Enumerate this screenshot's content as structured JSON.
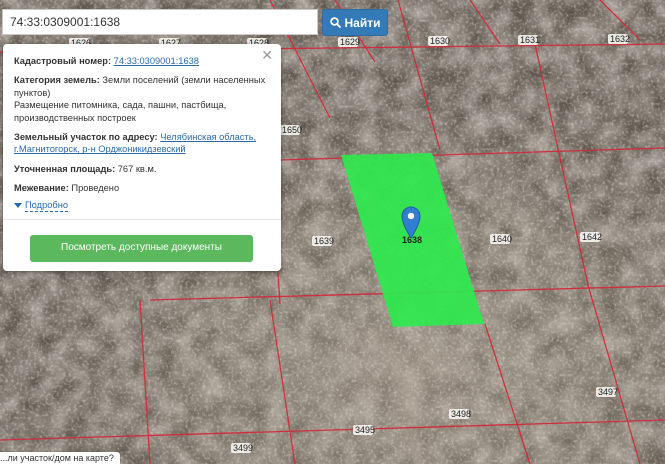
{
  "search": {
    "value": "74:33:0309001:1638",
    "button_label": "Найти"
  },
  "map": {
    "parcel_labels": [
      "1626",
      "1627",
      "1628",
      "1629",
      "1630",
      "1631",
      "1632",
      "1650",
      "1639",
      "1640",
      "1642",
      "1638",
      "3497",
      "3498",
      "3495",
      "3499"
    ],
    "selected_color": "#2ee84e",
    "boundary_color": "#d22a3a"
  },
  "popup": {
    "cadastral_label": "Кадастровый номер:",
    "cadastral_value": "74:33:0309001:1638",
    "category_label": "Категория земель:",
    "category_value": "Земли поселений (земли населенных пунктов)",
    "usage_value": "Размещение питомника, сада, пашни, пастбища, производственных построек",
    "address_label": "Земельный участок по адресу:",
    "address_value": "Челябинская область, г.Магнитогорск, р-н Орджоникидзевский",
    "area_label": "Уточненная площадь:",
    "area_value": "767 кв.м.",
    "survey_label": "Межевание:",
    "survey_value": "Проведено",
    "more_label": "Подробно",
    "docs_button": "Посмотреть доступные документы",
    "close_icon": "close-icon"
  },
  "bottom_hint": "...ли участок/дом на карте?"
}
